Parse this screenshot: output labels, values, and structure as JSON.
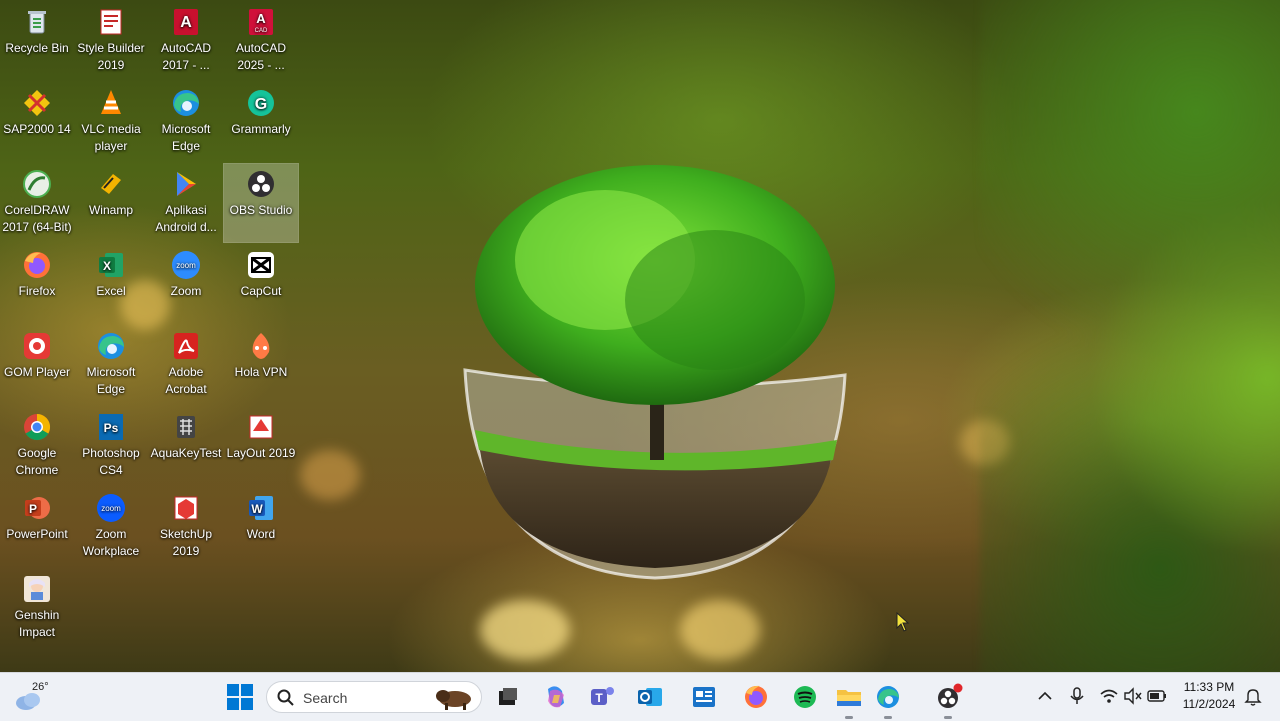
{
  "desktop": {
    "icons": [
      {
        "label": "Recycle Bin",
        "icon": "recycle-bin-icon"
      },
      {
        "label": "Style Builder 2019",
        "icon": "style-builder-icon"
      },
      {
        "label": "AutoCAD 2017 - ...",
        "icon": "autocad-2017-icon"
      },
      {
        "label": "AutoCAD 2025 - ...",
        "icon": "autocad-2025-icon"
      },
      {
        "label": "SAP2000 14",
        "icon": "sap2000-icon"
      },
      {
        "label": "VLC media player",
        "icon": "vlc-icon"
      },
      {
        "label": "Microsoft Edge",
        "icon": "edge-icon"
      },
      {
        "label": "Grammarly",
        "icon": "grammarly-icon"
      },
      {
        "label": "CorelDRAW 2017 (64-Bit)",
        "icon": "coreldraw-icon"
      },
      {
        "label": "Winamp",
        "icon": "winamp-icon"
      },
      {
        "label": "Aplikasi Android d...",
        "icon": "google-play-icon"
      },
      {
        "label": "OBS Studio",
        "icon": "obs-icon"
      },
      {
        "label": "Firefox",
        "icon": "firefox-icon"
      },
      {
        "label": "Excel",
        "icon": "excel-icon"
      },
      {
        "label": "Zoom",
        "icon": "zoom-icon"
      },
      {
        "label": "CapCut",
        "icon": "capcut-icon"
      },
      {
        "label": "GOM Player",
        "icon": "gom-player-icon"
      },
      {
        "label": "Microsoft Edge",
        "icon": "edge-icon"
      },
      {
        "label": "Adobe Acrobat",
        "icon": "acrobat-icon"
      },
      {
        "label": "Hola VPN",
        "icon": "hola-vpn-icon"
      },
      {
        "label": "Google Chrome",
        "icon": "chrome-icon"
      },
      {
        "label": "Photoshop CS4",
        "icon": "photoshop-icon"
      },
      {
        "label": "AquaKeyTest",
        "icon": "aquakeytest-icon"
      },
      {
        "label": "LayOut 2019",
        "icon": "layout-icon"
      },
      {
        "label": "PowerPoint",
        "icon": "powerpoint-icon"
      },
      {
        "label": "Zoom Workplace",
        "icon": "zoom-workplace-icon"
      },
      {
        "label": "SketchUp 2019",
        "icon": "sketchup-icon"
      },
      {
        "label": "Word",
        "icon": "word-icon"
      },
      {
        "label": "Genshin Impact",
        "icon": "genshin-icon"
      }
    ],
    "selected_icon": "OBS Studio"
  },
  "taskbar": {
    "weather_temp": "26°",
    "search_placeholder": "Search",
    "pinned_apps": [
      "start-icon",
      "task-view-icon",
      "copilot-icon",
      "teams-icon",
      "outlook-icon",
      "news-icon",
      "firefox-icon",
      "spotify-icon",
      "file-explorer-icon",
      "edge-icon",
      "obs-icon"
    ],
    "clock_time": "11:33 PM",
    "clock_date": "11/2/2024",
    "tray_icons": [
      "chevron-up-icon",
      "microphone-icon",
      "wifi-icon",
      "speaker-muted-icon",
      "battery-icon",
      "notification-bell-icon"
    ]
  },
  "colors": {
    "taskbar_bg": "#eef1f6",
    "windows_blue": "#0078d4"
  }
}
